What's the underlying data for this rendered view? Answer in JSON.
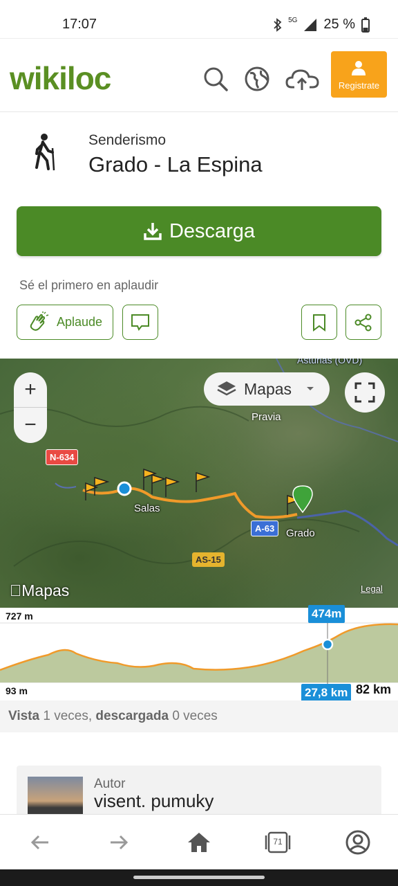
{
  "status_bar": {
    "time": "17:07",
    "network": "5G",
    "battery": "25 %"
  },
  "header": {
    "logo": "wikiloc",
    "icons": [
      "search-icon",
      "globe-icon",
      "cloud-upload-icon"
    ],
    "register_label": "Registrate"
  },
  "trail": {
    "activity_type": "Senderismo",
    "title": "Grado - La Espina",
    "download_label": "Descarga",
    "applaud_note": "Sé el primero en aplaudir",
    "applaud_label": "Aplaude"
  },
  "map": {
    "map_type_label": "Mapas",
    "zoom_in": "+",
    "zoom_out": "−",
    "places": {
      "pravia": "Pravia",
      "salas": "Salas",
      "grado": "Grado",
      "asturias": "Asturias (OVD)"
    },
    "roads": {
      "n634": "N-634",
      "a63": "A-63",
      "as15": "AS-15"
    },
    "attribution": "Mapas",
    "legal": "Legal"
  },
  "elevation": {
    "max_label": "727 m",
    "min_label": "93 m",
    "cursor_elevation": "474m",
    "cursor_distance": "27,8 km",
    "total_distance": "82 km"
  },
  "stats": {
    "vista_label": "Vista",
    "views": "1 veces,",
    "descargada_label": "descargada",
    "downloads": "0 veces"
  },
  "author": {
    "label": "Autor",
    "name": "visent. pumuky"
  },
  "bottom_nav": {
    "tabs_count": "71"
  },
  "colors": {
    "brand_green": "#4b8a26",
    "register_orange": "#f8a31b",
    "badge_blue": "#1a8fd8",
    "route_orange": "#f09a2a"
  }
}
